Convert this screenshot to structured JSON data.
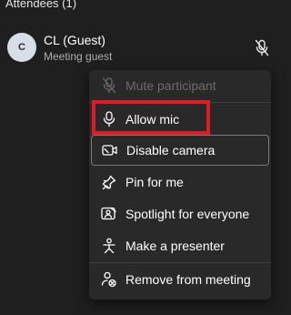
{
  "section": {
    "title": "Attendees (1)"
  },
  "attendee": {
    "initials": "C",
    "name": "CL (Guest)",
    "role": "Meeting guest"
  },
  "menu": {
    "items": [
      {
        "label": "Mute participant",
        "icon": "mic-off-icon",
        "disabled": true
      },
      {
        "label": "Allow mic",
        "icon": "mic-icon",
        "highlighted": true
      },
      {
        "label": "Disable camera",
        "icon": "camera-off-icon",
        "focused": true
      },
      {
        "label": "Pin for me",
        "icon": "pin-icon"
      },
      {
        "label": "Spotlight for everyone",
        "icon": "spotlight-icon"
      },
      {
        "label": "Make a presenter",
        "icon": "presenter-icon"
      },
      {
        "label": "Remove from meeting",
        "icon": "remove-person-icon"
      }
    ]
  },
  "colors": {
    "background": "#1f1f1f",
    "menu_background": "#292929",
    "highlight": "#e01b24"
  }
}
